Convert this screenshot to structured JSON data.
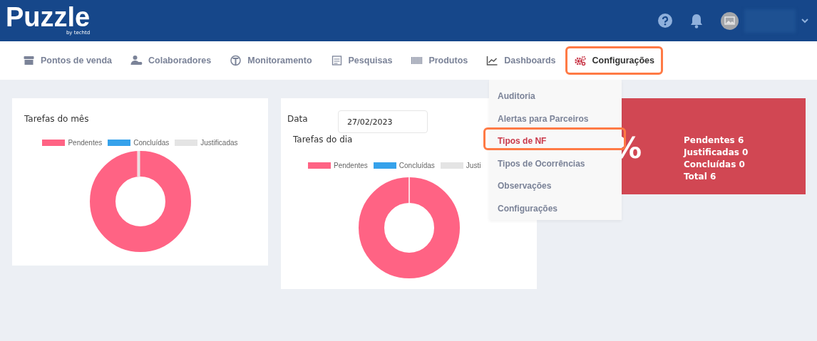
{
  "header": {
    "logo_title": "Puzzle",
    "logo_tagline": "by techtd"
  },
  "nav": [
    {
      "label": "Pontos de venda",
      "selected": false,
      "highlighted": false
    },
    {
      "label": "Colaboradores",
      "selected": false,
      "highlighted": false
    },
    {
      "label": "Monitoramento",
      "selected": false,
      "highlighted": false
    },
    {
      "label": "Pesquisas",
      "selected": false,
      "highlighted": false
    },
    {
      "label": "Produtos",
      "selected": false,
      "highlighted": false
    },
    {
      "label": "Dashboards",
      "selected": false,
      "highlighted": false
    },
    {
      "label": "Configurações",
      "selected": true,
      "highlighted": true
    }
  ],
  "dropdown": [
    {
      "label": "Auditoria",
      "selected": false,
      "highlighted": false
    },
    {
      "label": "Alertas para Parceiros",
      "selected": false,
      "highlighted": false
    },
    {
      "label": "Tipos de NF",
      "selected": true,
      "highlighted": true
    },
    {
      "label": "Tipos de Ocorrências",
      "selected": false,
      "highlighted": false
    },
    {
      "label": "Observações",
      "selected": false,
      "highlighted": false
    },
    {
      "label": "Configurações",
      "selected": false,
      "highlighted": false
    }
  ],
  "month_chart": {
    "title": "Tarefas do mês",
    "legend": [
      {
        "label": "Pendentes",
        "color": "#ff6384"
      },
      {
        "label": "Concluídas",
        "color": "#36a2eb"
      },
      {
        "label": "Justificadas",
        "color": "#e4e4e4"
      }
    ]
  },
  "day_chart": {
    "date_label": "Data",
    "date_value": "27/02/2023",
    "title": "Tarefas do dia",
    "legend": [
      {
        "label": "Pendentes",
        "color": "#ff6384"
      },
      {
        "label": "Concluídas",
        "color": "#36a2eb"
      },
      {
        "label": "Justi",
        "color": "#e4e4e4"
      }
    ]
  },
  "summary_card": {
    "percent": "%",
    "lines": [
      "Pendentes 6",
      "Justificadas 0",
      "Concluídas 0",
      "Total 6"
    ]
  }
}
